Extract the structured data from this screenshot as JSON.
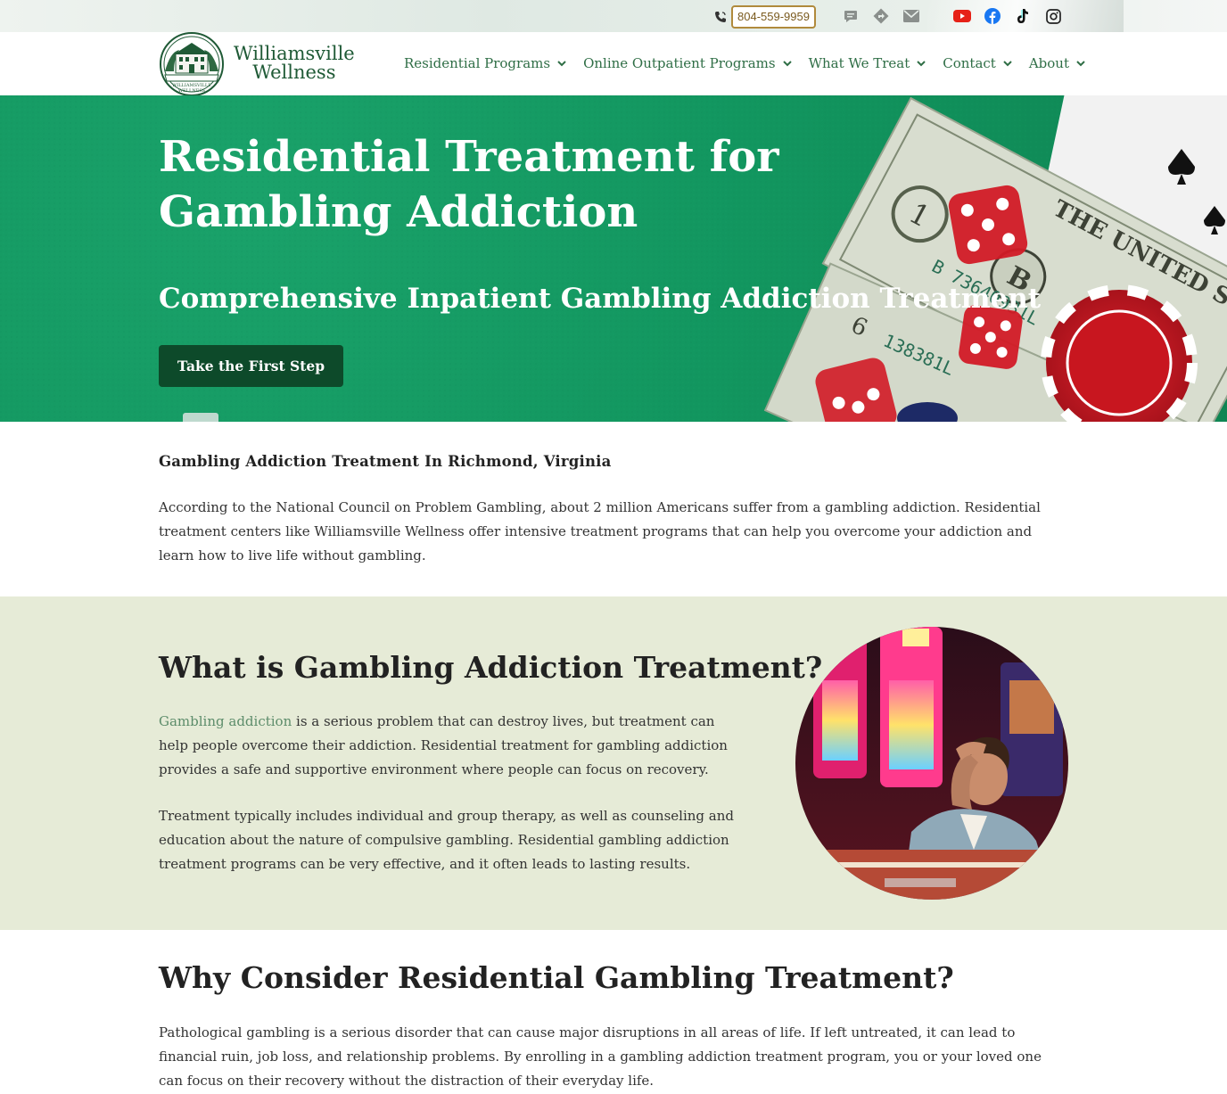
{
  "topbar": {
    "phone": "804-559-9959",
    "icons": [
      "phone-icon",
      "chat-icon",
      "directions-icon",
      "mail-icon",
      "youtube-icon",
      "facebook-icon",
      "tiktok-icon",
      "instagram-icon"
    ]
  },
  "brand": {
    "name_line1": "Williamsville",
    "name_line2": "Wellness",
    "seal_text": "WILLIAMSVILLE WELLNESS"
  },
  "nav": {
    "items": [
      {
        "label": "Residential Programs"
      },
      {
        "label": "Online Outpatient Programs"
      },
      {
        "label": "What We Treat"
      },
      {
        "label": "Contact"
      },
      {
        "label": "About"
      }
    ]
  },
  "hero": {
    "title": "Residential Treatment for Gambling Addiction",
    "subtitle": "Comprehensive Inpatient Gambling Addiction Treatment",
    "cta": "Take the First Step",
    "bill_text": "THE UNITED STATES",
    "bill_serial": "B 73640931L",
    "bill_serial2": "138381L"
  },
  "intro": {
    "heading": "Gambling Addiction Treatment In Richmond, Virginia",
    "body": "According to the National Council on Problem Gambling, about 2 million Americans suffer from a gambling addiction. Residential treatment centers like Williamsville Wellness offer intensive treatment programs that can help you overcome your addiction and learn how to live life without gambling."
  },
  "what": {
    "title": "What is Gambling Addiction Treatment?",
    "p1_link": "Gambling addiction",
    "p1_rest": " is a serious problem that can destroy lives, but treatment can help people overcome their addiction. Residential treatment for gambling addiction provides a safe and supportive environment where people can focus on recovery.",
    "p2": "Treatment typically includes individual and group therapy, as well as counseling and education about the nature of compulsive gambling. Residential gambling addiction treatment programs can be very effective, and it often leads to lasting results."
  },
  "why": {
    "title": "Why Consider Residential Gambling Treatment?",
    "body": "Pathological gambling is a serious disorder that can cause major disruptions in all areas of life. If left untreated, it can lead to financial ruin, job loss, and relationship problems. By enrolling in a gambling addiction treatment program, you or your loved one can focus on their recovery without the distraction of their everyday life."
  },
  "colors": {
    "brand_green": "#1f5a36",
    "nav_green": "#2f6e46",
    "hero_green": "#12965f",
    "button_dark": "#0d4a2a",
    "section_bg": "#e6ebd7",
    "phone_border": "#b08a3c"
  }
}
